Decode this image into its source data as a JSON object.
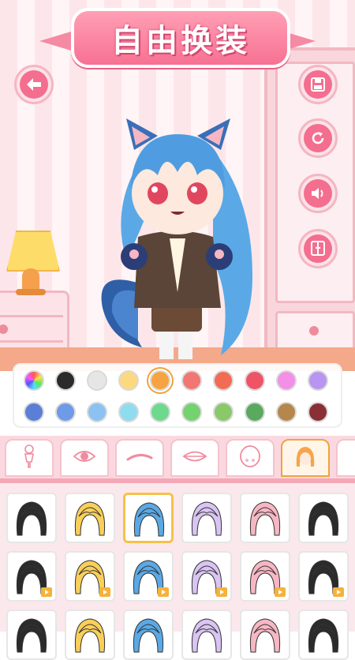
{
  "header": {
    "title": "自由换装"
  },
  "toolbar": {
    "back": {
      "icon": "back-arrow-icon"
    },
    "save": {
      "icon": "save-icon"
    },
    "reset": {
      "icon": "refresh-icon"
    },
    "sound": {
      "icon": "speaker-icon"
    },
    "wardrobe": {
      "icon": "wardrobe-icon"
    }
  },
  "palette": {
    "colors": [
      "rainbow",
      "#2b2b2b",
      "#e6e6e6",
      "#fcd980",
      "#f7a341",
      "#f27673",
      "#f26c54",
      "#ee5466",
      "#f38fe6",
      "#b795f0",
      "#5b7fd6",
      "#6f9ae8",
      "#8bc2f2",
      "#90dcef",
      "#6ed98c",
      "#74d36f",
      "#8ac86a",
      "#5aa95e",
      "#b5874d",
      "#8a2f36"
    ],
    "selected_index": 4
  },
  "category_tabs": [
    {
      "icon": "body-icon"
    },
    {
      "icon": "eye-icon"
    },
    {
      "icon": "eyebrow-icon"
    },
    {
      "icon": "mouth-icon"
    },
    {
      "icon": "face-icon"
    },
    {
      "icon": "hair-icon",
      "active": true
    }
  ],
  "items": {
    "row1": [
      {
        "hair": "#2b2b2b",
        "premium": false
      },
      {
        "hair": "#f9cf5a",
        "premium": false
      },
      {
        "hair": "#5aa9e6",
        "premium": false,
        "selected": true
      },
      {
        "hair": "#d9c4f3",
        "premium": false
      },
      {
        "hair": "#f6b7c3",
        "premium": false
      },
      {
        "hair": "#2b2b2b",
        "premium": false
      }
    ],
    "row2": [
      {
        "hair": "#2b2b2b",
        "premium": true
      },
      {
        "hair": "#f9cf5a",
        "premium": true
      },
      {
        "hair": "#5aa9e6",
        "premium": true
      },
      {
        "hair": "#d9c4f3",
        "premium": true
      },
      {
        "hair": "#f6b7c3",
        "premium": true
      },
      {
        "hair": "#2b2b2b",
        "premium": true
      }
    ],
    "row3": [
      {
        "hair": "#2b2b2b",
        "premium": false
      },
      {
        "hair": "#f9cf5a",
        "premium": false
      },
      {
        "hair": "#5aa9e6",
        "premium": false
      },
      {
        "hair": "#d9c4f3",
        "premium": false
      },
      {
        "hair": "#f6b7c3",
        "premium": false
      },
      {
        "hair": "#2b2b2b",
        "premium": false
      }
    ]
  }
}
